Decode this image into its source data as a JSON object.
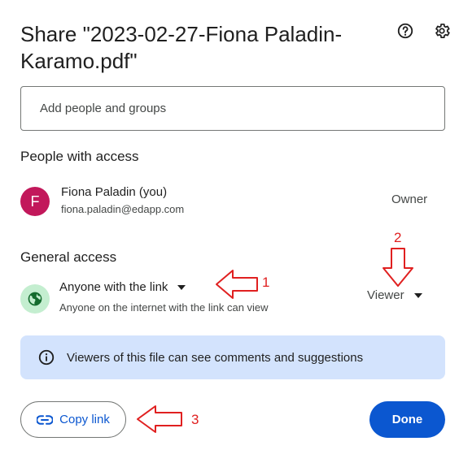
{
  "dialog": {
    "title": "Share \"2023-02-27-Fiona Paladin-Karamo.pdf\"",
    "help_icon": "help-circle-icon",
    "settings_icon": "gear-icon"
  },
  "add_people": {
    "placeholder": "Add people and groups"
  },
  "people_section": {
    "heading": "People with access",
    "people": [
      {
        "initial": "F",
        "name": "Fiona Paladin (you)",
        "email": "fiona.paladin@edapp.com",
        "role": "Owner",
        "avatar_color": "#c2185b"
      }
    ]
  },
  "general_access": {
    "heading": "General access",
    "link_setting": "Anyone with the link",
    "description": "Anyone on the internet with the link can view",
    "role": "Viewer",
    "icon": "globe-icon"
  },
  "info_banner": {
    "text": "Viewers of this file can see comments and suggestions",
    "icon": "info-icon"
  },
  "footer": {
    "copy_link_label": "Copy link",
    "done_label": "Done"
  },
  "annotations": [
    "1",
    "2",
    "3"
  ],
  "colors": {
    "primary": "#0b57d0",
    "banner": "#d3e3fd",
    "globe_bg": "#c4eed0",
    "annotation": "#e02020"
  }
}
